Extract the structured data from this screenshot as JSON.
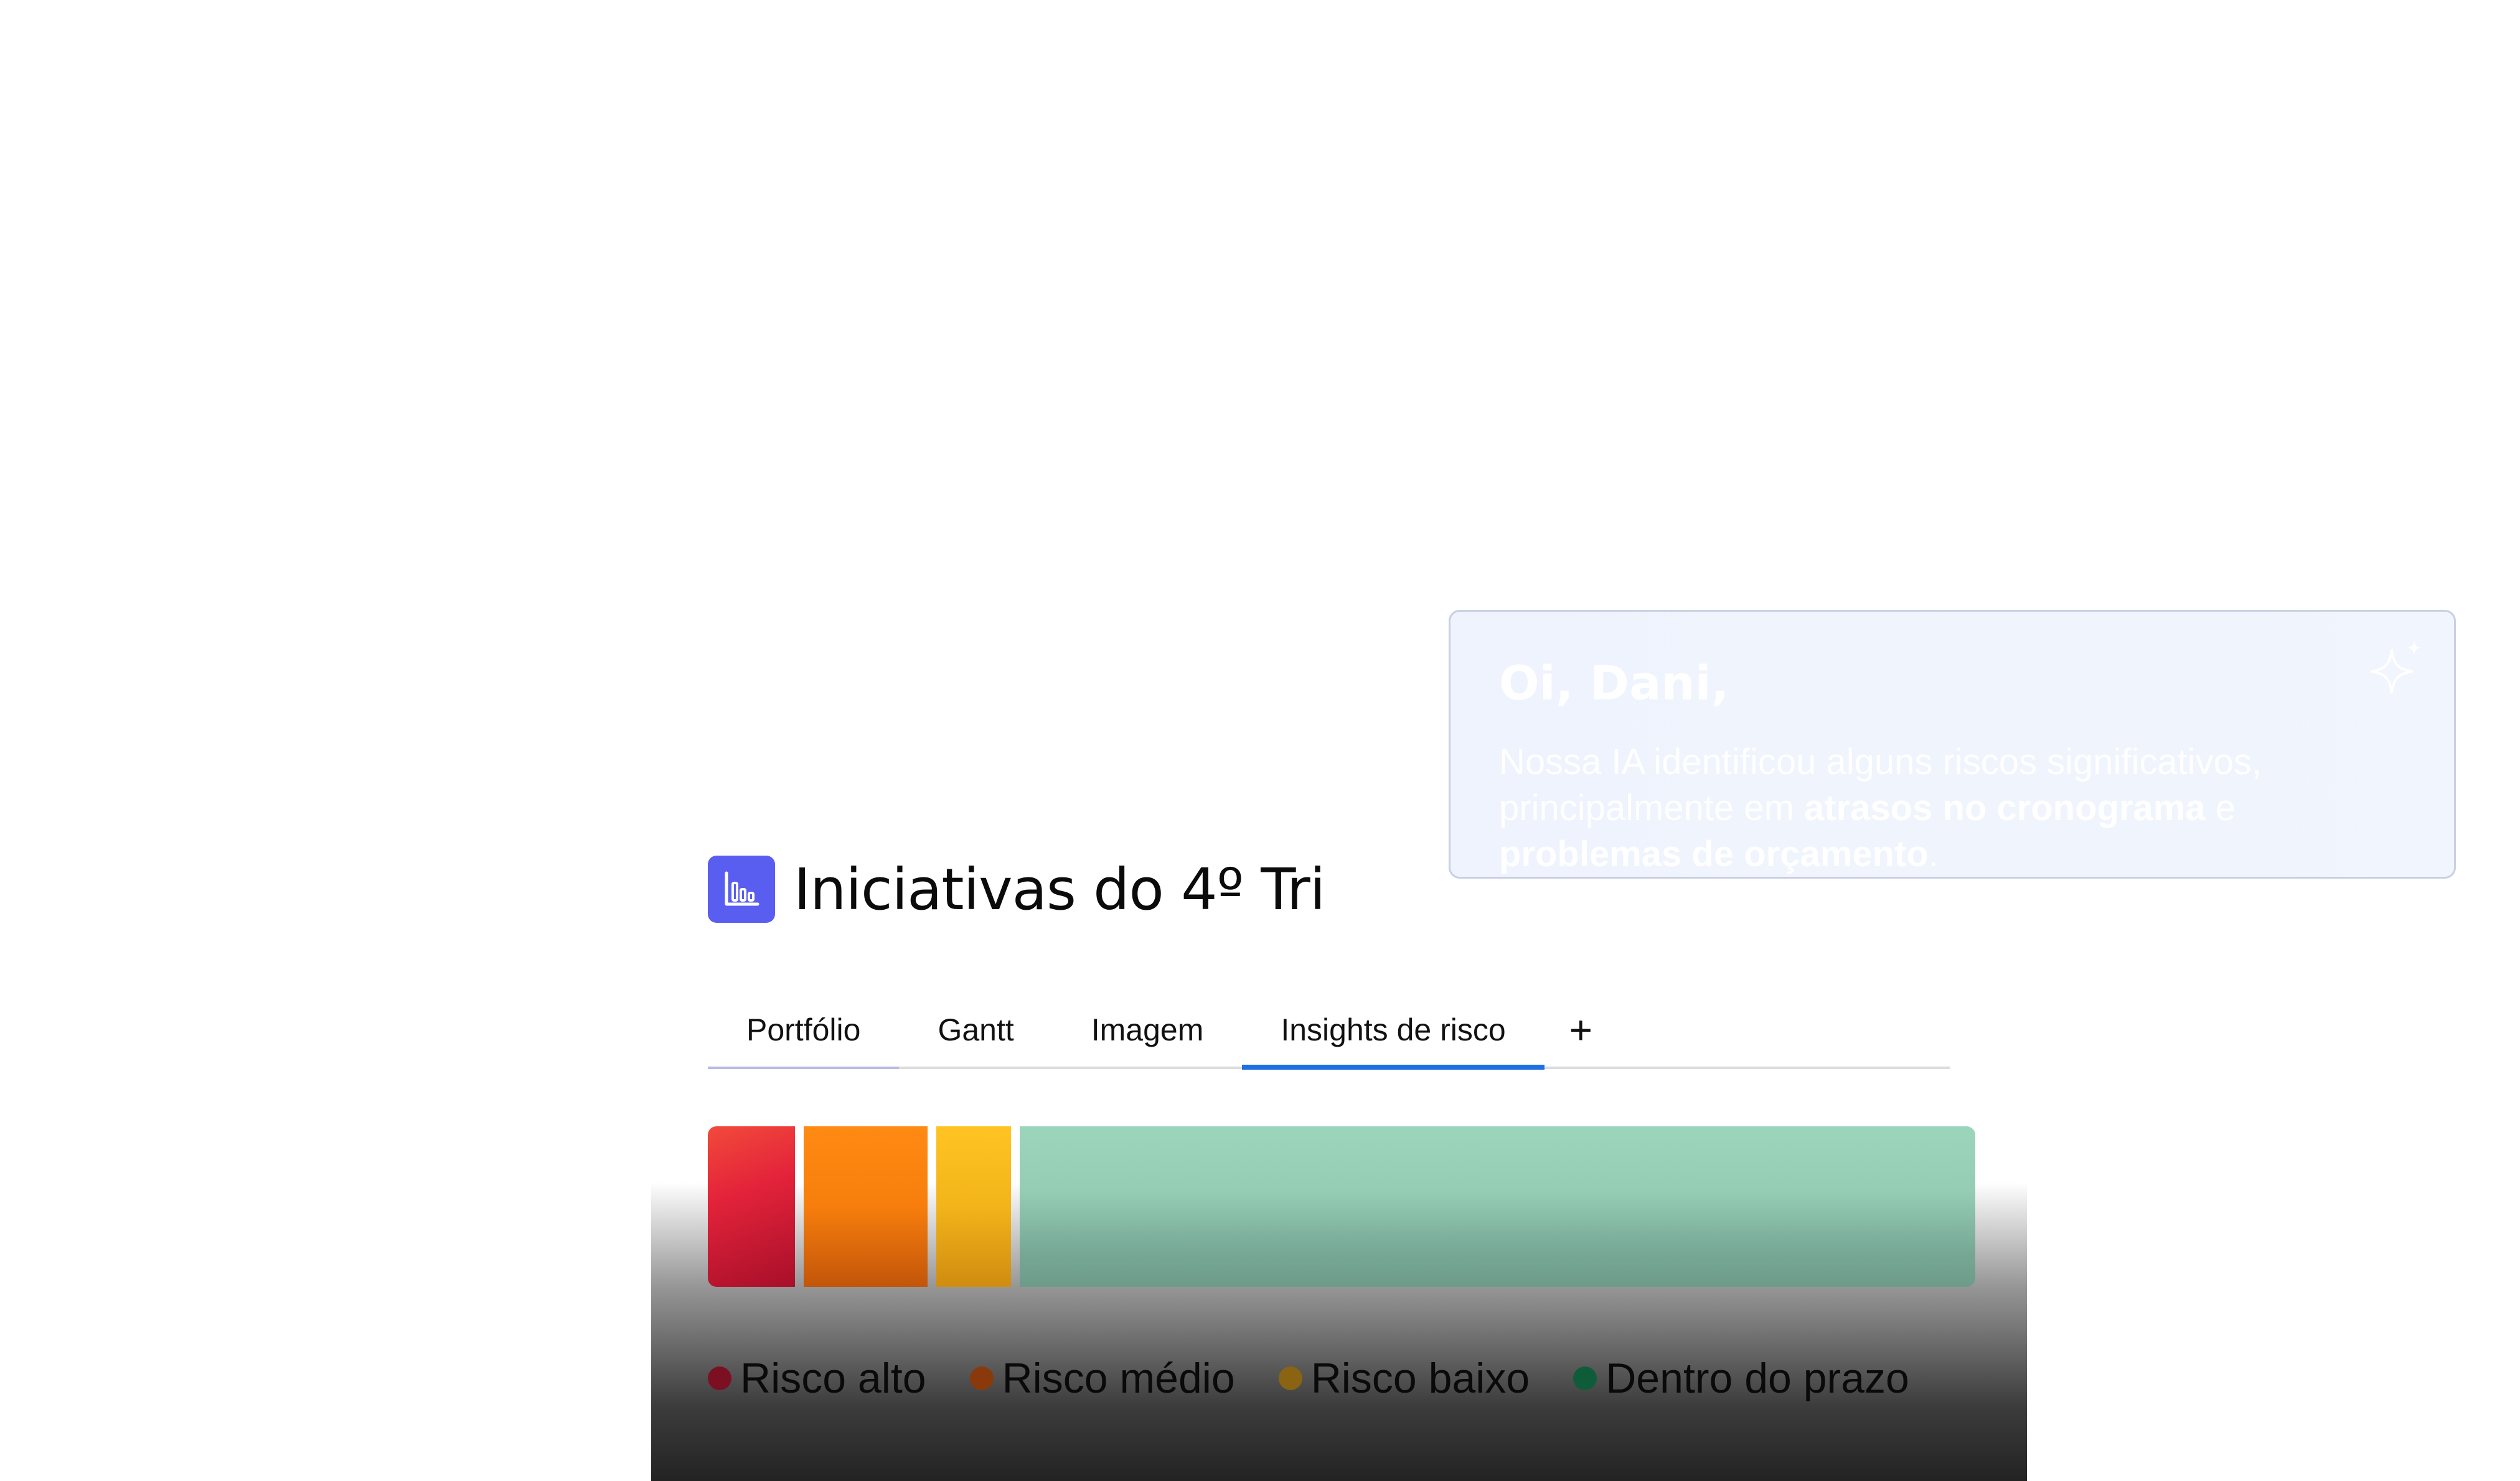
{
  "page": {
    "title": "Iniciativas do 4º Tri",
    "title_icon": "bar-chart-icon",
    "accent_color": "#5a5ef0"
  },
  "tabs": {
    "items": [
      {
        "label": "Portfólio"
      },
      {
        "label": "Gantt"
      },
      {
        "label": "Imagem"
      },
      {
        "label": "Insights de risco"
      }
    ],
    "add_label": "+",
    "active_index": 3,
    "active_color": "#1f6fe0"
  },
  "risk_bar": {
    "segments": [
      {
        "name": "Risco alto",
        "share": 0.07,
        "color": "#e3233a"
      },
      {
        "name": "Risco médio",
        "share": 0.1,
        "color": "#f77e0c"
      },
      {
        "name": "Risco baixo",
        "share": 0.06,
        "color": "#f2b41a"
      },
      {
        "name": "Dentro do prazo",
        "share": 0.77,
        "color": "#95cdb4"
      }
    ]
  },
  "legend": {
    "items": [
      {
        "label": "Risco alto",
        "color": "#7d0f22"
      },
      {
        "label": "Risco médio",
        "color": "#8a3a0a"
      },
      {
        "label": "Risco baixo",
        "color": "#8a6412"
      },
      {
        "label": "Dentro do prazo",
        "color": "#0f5c3a"
      }
    ]
  },
  "ai_card": {
    "greeting": "Oi, Dani,",
    "message_part1": "Nossa IA identificou alguns riscos significativos, principalmente em ",
    "message_bold1": "atrasos no cronograma",
    "message_part2": " e ",
    "message_bold2": "problemas de orçamento",
    "message_part3": ".",
    "icon": "sparkle-icon"
  }
}
